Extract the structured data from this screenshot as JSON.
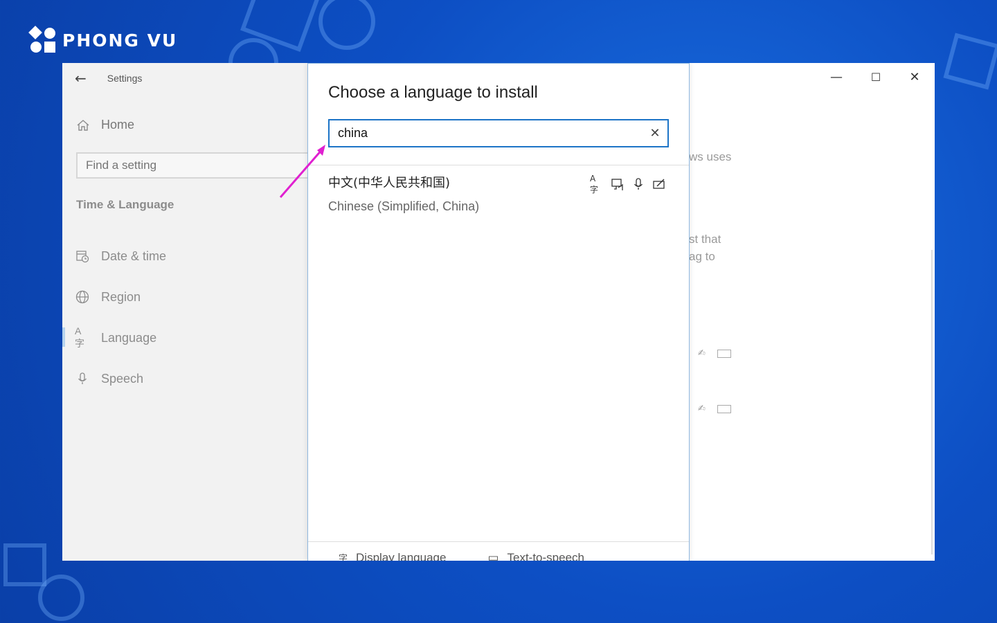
{
  "brand": {
    "name": "PHONG VU"
  },
  "window": {
    "title": "Settings",
    "controls": {
      "minimize": "—",
      "maximize": "☐",
      "close": "✕"
    }
  },
  "sidebar": {
    "home_label": "Home",
    "search_placeholder": "Find a setting",
    "section_title": "Time & Language",
    "items": [
      {
        "label": "Date & time",
        "icon": "calendar-clock-icon"
      },
      {
        "label": "Region",
        "icon": "globe-icon"
      },
      {
        "label": "Language",
        "icon": "language-icon",
        "active": true
      },
      {
        "label": "Speech",
        "icon": "microphone-icon"
      }
    ]
  },
  "background_page": {
    "fragment_1": "ws uses",
    "fragment_2": "st that",
    "fragment_3": "ag to"
  },
  "dialog": {
    "title": "Choose a language to install",
    "search_value": "china",
    "results": [
      {
        "native_name": "中文(中华人民共和国)",
        "english_name": "Chinese (Simplified, China)",
        "features": [
          "display-language-icon",
          "text-to-speech-icon",
          "speech-recognition-icon",
          "handwriting-icon"
        ]
      }
    ],
    "footer": {
      "display_language": "Display language",
      "text_to_speech": "Text-to-speech"
    }
  },
  "colors": {
    "accent": "#1c74c7",
    "annotation_arrow": "#e020d0",
    "background": "#0d4fc4"
  }
}
